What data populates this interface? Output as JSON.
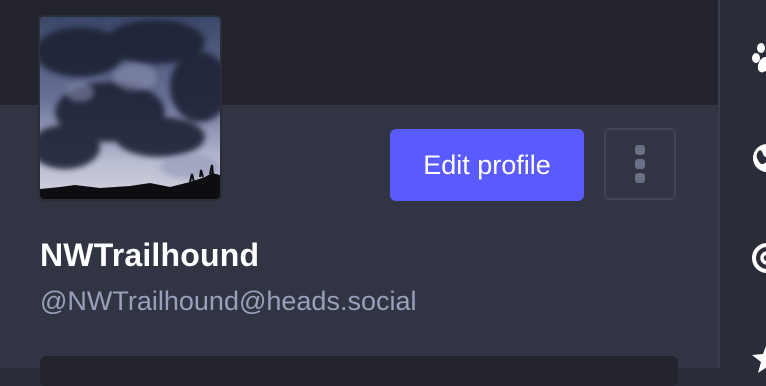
{
  "profile": {
    "display_name": "NWTrailhound",
    "handle": "@NWTrailhound@heads.social",
    "edit_button_label": "Edit profile",
    "avatar_icon": "cloudy-sky-photo",
    "menu_icon": "vertical-ellipsis-icon"
  },
  "sidebar_icons": [
    "paw-icon",
    "globe-icon",
    "at-icon",
    "star-icon"
  ],
  "colors": {
    "accent": "#595aff",
    "background": "#313543",
    "banner": "#22232c",
    "handle_text": "#9aa0bb"
  }
}
